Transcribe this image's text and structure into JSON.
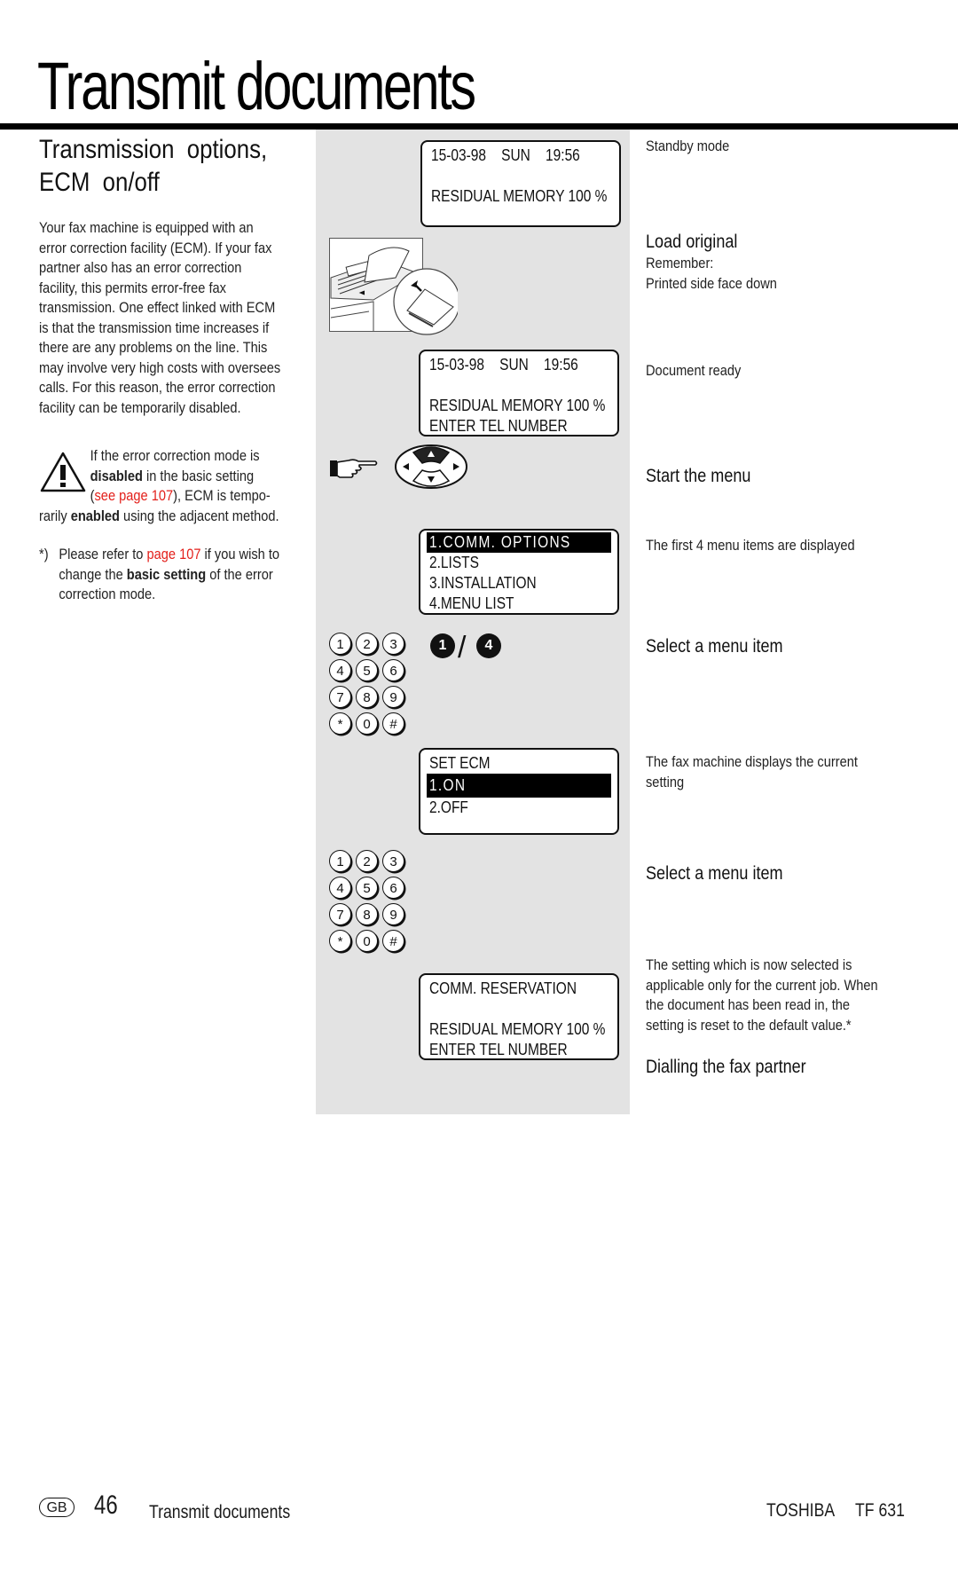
{
  "header": {
    "title": "Transmit documents"
  },
  "section": {
    "title_line1": "Transmission  options,",
    "title_line2": "ECM  on/off"
  },
  "intro": {
    "lines": [
      "Your fax machine is equipped with an",
      "error correction facility (ECM). If your fax",
      "partner also has an error correction",
      "facility, this permits error-free fax",
      "transmission. One effect linked with ECM",
      "is that the transmission time increases if",
      "there are any problems on the line. This",
      "may involve very high costs with oversees",
      "calls. For this reason, the error correction",
      "facility can be temporarily disabled."
    ]
  },
  "warning": {
    "icon": "warning-triangle-icon",
    "line1": "If the error correction mode is",
    "line2_bold": "disabled",
    "line2_rest": " in the basic setting",
    "line3_open": "(",
    "line3_link": "see page 107",
    "line3_rest": "), ECM is tempo-",
    "line4_pre": "rarily ",
    "line4_bold": "enabled",
    "line4_rest": " using the adjacent method."
  },
  "footnote": {
    "mark": "*)",
    "line1_pre": "Please refer to ",
    "line1_link": "page 107",
    "line1_rest": " if you wish to",
    "line2_pre": "change the ",
    "line2_bold": "basic setting",
    "line2_rest": " of the error",
    "line3": "correction mode."
  },
  "colors": {
    "link": "#e3201b",
    "panel": "#e3e3e3",
    "text": "#1a1a1a"
  },
  "displays": {
    "standby": {
      "line1": "15-03-98    SUN    19:56",
      "line2": "RESIDUAL MEMORY 100 %"
    },
    "ready": {
      "line1": "15-03-98    SUN    19:56",
      "line2": "RESIDUAL MEMORY 100 %",
      "line3": "ENTER TEL NUMBER"
    },
    "menu": {
      "items": [
        "1.COMM. OPTIONS",
        "2.LISTS",
        "3.INSTALLATION",
        "4.MENU LIST"
      ],
      "selected_index": 0
    },
    "ecm": {
      "title": "SET ECM",
      "options": [
        "1.ON",
        "2.OFF"
      ],
      "selected_index": 0
    },
    "reservation": {
      "line1": "COMM. RESERVATION",
      "line2": "RESIDUAL MEMORY 100 %",
      "line3": "ENTER TEL NUMBER"
    }
  },
  "illustrations": {
    "load_original": "fax-document-loading-illustration",
    "pointer": "pointing-hand-icon",
    "nav_pad": "navigation-pad-icon",
    "keypad_keys": [
      "1",
      "2",
      "3",
      "4",
      "5",
      "6",
      "7",
      "8",
      "9",
      "*",
      "0",
      "#"
    ],
    "select_badges": {
      "from": "1",
      "to": "4",
      "separator": "/"
    }
  },
  "steps": {
    "standby": "Standby mode",
    "load_head": "Load original",
    "load_sub1": "Remember:",
    "load_sub2": "Printed side face down",
    "doc_ready": "Document ready",
    "start_menu": "Start the menu",
    "first_four": "The first 4 menu items are displayed",
    "select_item_1": "Select a menu item",
    "current_setting_1": "The fax machine displays the current",
    "current_setting_2": "setting",
    "select_item_2": "Select a menu item",
    "note_lines": [
      "The setting which is now selected is",
      "applicable only for the current job. When",
      "the document has been read in, the",
      "setting is reset to the default value.*"
    ],
    "dialling": "Dialling the fax partner"
  },
  "footer": {
    "country": "GB",
    "page_number": "46",
    "section": "Transmit documents",
    "brand": "TOSHIBA",
    "model": "TF 631"
  }
}
